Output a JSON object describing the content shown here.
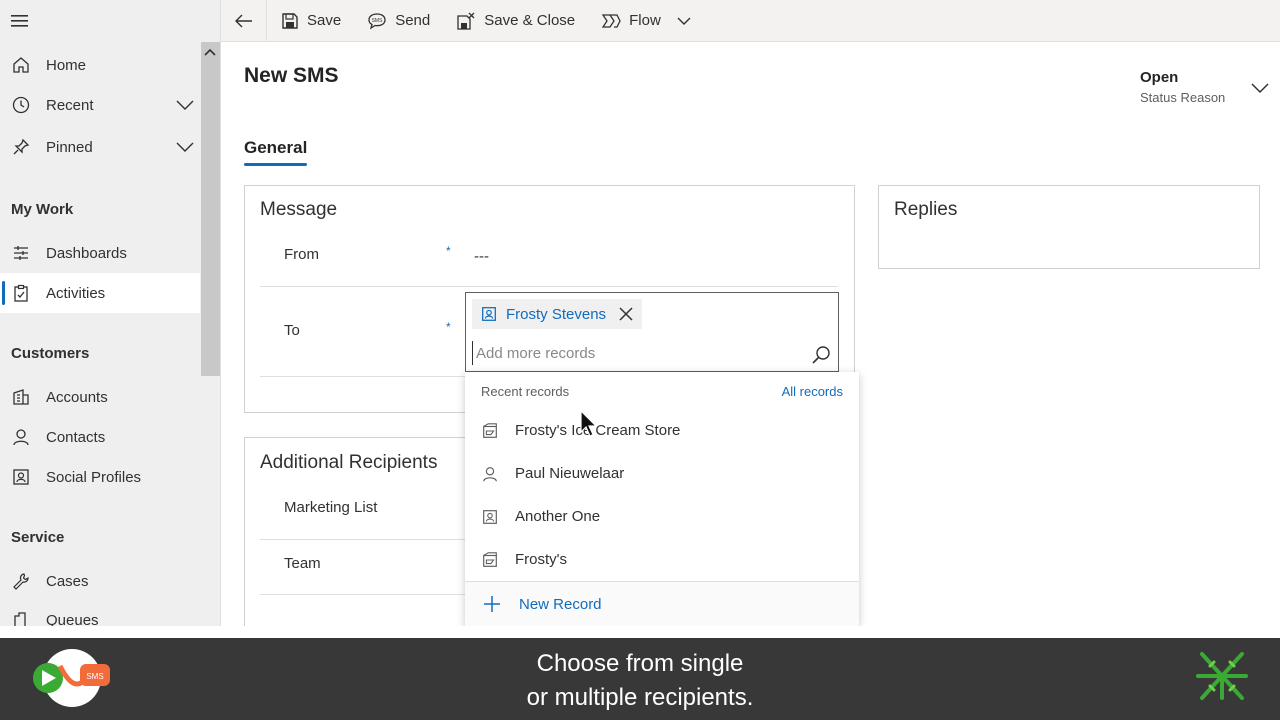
{
  "sidebar": {
    "items": {
      "home": "Home",
      "recent": "Recent",
      "pinned": "Pinned",
      "dashboards": "Dashboards",
      "activities": "Activities",
      "accounts": "Accounts",
      "contacts": "Contacts",
      "social_profiles": "Social Profiles",
      "cases": "Cases",
      "queues": "Queues"
    },
    "groups": {
      "my_work": "My Work",
      "customers": "Customers",
      "service": "Service"
    }
  },
  "toolbar": {
    "save": "Save",
    "send": "Send",
    "save_close": "Save & Close",
    "flow": "Flow"
  },
  "header": {
    "title": "New SMS",
    "status_value": "Open",
    "status_label": "Status Reason"
  },
  "tabs": {
    "general": "General"
  },
  "message": {
    "title": "Message",
    "from_label": "From",
    "from_value": "---",
    "to_label": "To",
    "required_marker": "*",
    "selected_recipient": "Frosty Stevens",
    "lookup_placeholder": "Add more records"
  },
  "replies": {
    "title": "Replies"
  },
  "additional": {
    "title": "Additional Recipients",
    "marketing_list": "Marketing List",
    "team": "Team"
  },
  "dropdown": {
    "header": "Recent records",
    "all_records": "All records",
    "items": [
      {
        "label": "Frosty's Ice Cream Store",
        "icon": "account-icon"
      },
      {
        "label": "Paul Nieuwelaar",
        "icon": "contact-icon"
      },
      {
        "label": "Another One",
        "icon": "social-profile-icon"
      },
      {
        "label": "Frosty's",
        "icon": "account-icon"
      }
    ],
    "new_record": "New Record"
  },
  "banner": {
    "caption_line1": "Choose from single",
    "caption_line2": "or multiple recipients."
  },
  "colors": {
    "accent": "#0f6cbd",
    "banner": "#383838",
    "logo_green": "#3aaa35",
    "logo_orange": "#f26b3a"
  }
}
